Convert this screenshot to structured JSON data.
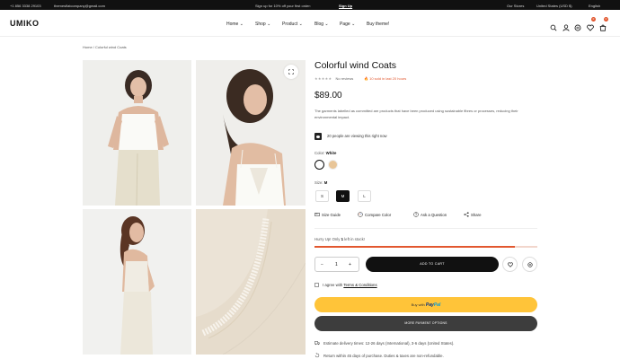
{
  "topbar": {
    "phone": "+1 856 3338 29103",
    "email": "themesflatcompany@gmail.com",
    "promo_text": "Sign up for 10% off your first order:",
    "signup_link": "Sign Up",
    "stores_label": "Our Stores",
    "currency": "United States (USD $)",
    "language": "English"
  },
  "header": {
    "logo": "UMIKO",
    "nav": [
      "Home",
      "Shop",
      "Product",
      "Blog",
      "Page",
      "Buy theme!"
    ],
    "cart_count": "0",
    "wishlist_count": "0"
  },
  "breadcrumb": "Home  /  Colorful wind Coats",
  "product": {
    "title": "Colorful wind Coats",
    "stars": "★★★★★",
    "reviews": "No reviews",
    "sold_text": "10 sold in last 20 hours",
    "price": "$89.00",
    "description": "The garments labelled as committed are products that have been produced using sustainable fibres or processes, reducing their environmental impact.",
    "viewing": "20 people are viewing this right now",
    "color_label": "Color:",
    "color_value": "White",
    "size_label": "Size:",
    "size_value": "M",
    "sizes": [
      "S",
      "M",
      "L"
    ],
    "links": [
      "Size Guide",
      "Compare Color",
      "Ask a Question",
      "Share"
    ],
    "hurry_prefix": "Hurry Up! Only",
    "hurry_count": "1",
    "hurry_suffix": "left in stock!",
    "stock_fraction": 0.9,
    "qty": "1",
    "add_to_cart": "ADD TO CART",
    "agree_text": "I agree with",
    "terms_link": "Terms & Conditions",
    "paypal_prefix": "Buy with",
    "paypal_brand_1": "Pay",
    "paypal_brand_2": "Pal",
    "more_payment": "MORE PAYMENT OPTIONS",
    "delivery": "Estimate delivery times: 12-26 days (International), 3-6 days (United States).",
    "returns": "Return within 45 days of purchase. Duties & taxes are non-refundable."
  },
  "colors": {
    "accent": "#e2572f",
    "paypal": "#ffc439",
    "swatch_white": "#ffffff",
    "swatch_beige": "#e8c598"
  }
}
